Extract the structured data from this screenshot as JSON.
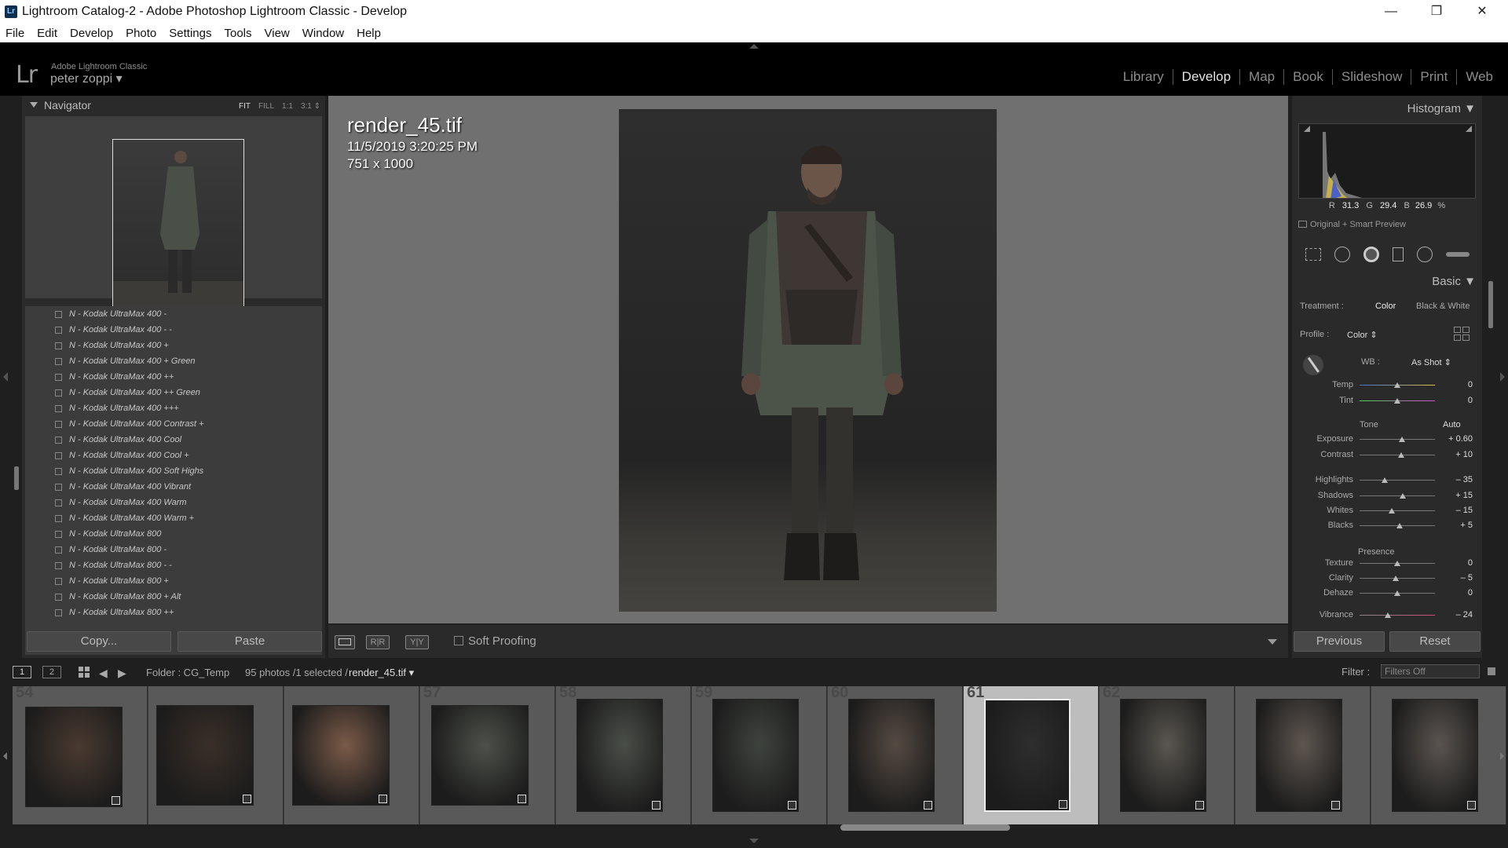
{
  "window": {
    "title": "Lightroom Catalog-2 - Adobe Photoshop Lightroom Classic - Develop",
    "app_icon": "Lr",
    "minimize": "—",
    "maximize": "❐",
    "close": "✕"
  },
  "menu": [
    "File",
    "Edit",
    "Develop",
    "Photo",
    "Settings",
    "Tools",
    "View",
    "Window",
    "Help"
  ],
  "identity": {
    "logo": "Lr",
    "brand": "Adobe Lightroom Classic",
    "user": "peter zoppi ▾"
  },
  "modules": [
    "Library",
    "Develop",
    "Map",
    "Book",
    "Slideshow",
    "Print",
    "Web"
  ],
  "active_module": "Develop",
  "navigator": {
    "title": "Navigator",
    "zoom": [
      "FIT",
      "FILL",
      "1:1",
      "3:1 ⇕"
    ]
  },
  "presets": [
    "N - Kodak UltraMax 400 -",
    "N - Kodak UltraMax 400 - -",
    "N - Kodak UltraMax 400 +",
    "N - Kodak UltraMax 400 + Green",
    "N - Kodak UltraMax 400 ++",
    "N - Kodak UltraMax 400 ++ Green",
    "N - Kodak UltraMax 400 +++",
    "N - Kodak UltraMax 400 Contrast +",
    "N - Kodak UltraMax 400 Cool",
    "N - Kodak UltraMax 400 Cool +",
    "N - Kodak UltraMax 400 Soft Highs",
    "N - Kodak UltraMax 400 Vibrant",
    "N - Kodak UltraMax 400 Warm",
    "N - Kodak UltraMax 400 Warm +",
    "N - Kodak UltraMax 800",
    "N - Kodak UltraMax 800 -",
    "N - Kodak UltraMax 800 - -",
    "N - Kodak UltraMax 800 +",
    "N - Kodak UltraMax 800 + Alt",
    "N - Kodak UltraMax 800 ++"
  ],
  "left_buttons": {
    "copy": "Copy...",
    "paste": "Paste"
  },
  "image_info": {
    "filename": "render_45.tif",
    "datetime": "11/5/2019 3:20:25 PM",
    "dimensions": "751 x 1000"
  },
  "toolbar": {
    "soft_proofing": "Soft Proofing",
    "compare1": "R|R",
    "compare2": "Y|Y"
  },
  "histogram": {
    "title": "Histogram ▼",
    "r_label": "R",
    "r": "31.3",
    "g_label": "G",
    "g": "29.4",
    "b_label": "B",
    "b": "26.9",
    "pct": "%",
    "smart_preview": "Original + Smart Preview"
  },
  "basic": {
    "title": "Basic ▼",
    "treatment_label": "Treatment :",
    "treatment_color": "Color",
    "treatment_bw": "Black & White",
    "profile_label": "Profile :",
    "profile_value": "Color ⇕",
    "wb_label": "WB :",
    "wb_value": "As Shot ⇕",
    "tone_label": "Tone",
    "auto_label": "Auto",
    "presence_label": "Presence",
    "sliders": [
      {
        "label": "Temp",
        "value": "0",
        "pos": 0.5
      },
      {
        "label": "Tint",
        "value": "0",
        "pos": 0.5
      },
      {
        "label": "Exposure",
        "value": "+ 0.60",
        "pos": 0.56
      },
      {
        "label": "Contrast",
        "value": "+ 10",
        "pos": 0.55
      },
      {
        "label": "Highlights",
        "value": "– 35",
        "pos": 0.33
      },
      {
        "label": "Shadows",
        "value": "+ 15",
        "pos": 0.57
      },
      {
        "label": "Whites",
        "value": "– 15",
        "pos": 0.43
      },
      {
        "label": "Blacks",
        "value": "+ 5",
        "pos": 0.53
      },
      {
        "label": "Texture",
        "value": "0",
        "pos": 0.5
      },
      {
        "label": "Clarity",
        "value": "– 5",
        "pos": 0.48
      },
      {
        "label": "Dehaze",
        "value": "0",
        "pos": 0.5
      },
      {
        "label": "Vibrance",
        "value": "– 24",
        "pos": 0.38
      }
    ]
  },
  "right_buttons": {
    "previous": "Previous",
    "reset": "Reset"
  },
  "filmstrip_bar": {
    "view1": "1",
    "view2": "2",
    "folder": "Folder : CG_Temp",
    "count": "95 photos /1 selected /",
    "current": "render_45.tif ▾",
    "filter_label": "Filter :",
    "filter_value": "Filters Off"
  },
  "filmstrip": [
    {
      "num": "54",
      "selected": false
    },
    {
      "num": "",
      "selected": false
    },
    {
      "num": "",
      "selected": false
    },
    {
      "num": "57",
      "selected": false
    },
    {
      "num": "58",
      "selected": false
    },
    {
      "num": "59",
      "selected": false
    },
    {
      "num": "60",
      "selected": false
    },
    {
      "num": "61",
      "selected": true
    },
    {
      "num": "62",
      "selected": false
    },
    {
      "num": "",
      "selected": false
    },
    {
      "num": "",
      "selected": false
    }
  ]
}
